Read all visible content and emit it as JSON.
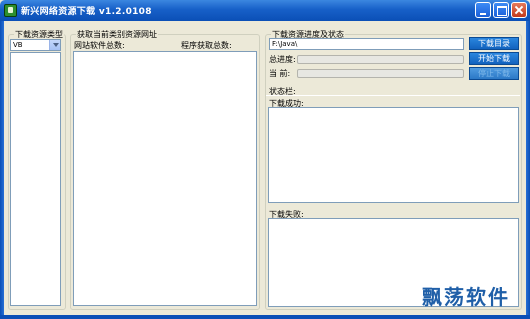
{
  "window": {
    "title": "新兴网络资源下载 v1.2.0108"
  },
  "resource_type": {
    "group_label": "下载资源类型",
    "combo_value": "VB"
  },
  "category_urls": {
    "group_label": "获取当前类别资源网址",
    "site_total_label": "网站软件总数:",
    "fetched_total_label": "程序获取总数:"
  },
  "download_status": {
    "group_label": "下载资源进度及状态",
    "path_value": "F:\\Java\\",
    "total_progress_label": "总进度:",
    "current_label": "当  前:",
    "total_progress": 0,
    "current_progress": 0,
    "status_label": "状态栏:",
    "success_label": "下载成功:",
    "failed_label": "下载失败:"
  },
  "buttons": {
    "dir_label": "下载目录",
    "start_label": "开始下载",
    "stop_label": "停止下载"
  },
  "watermark": "飘荡软件"
}
